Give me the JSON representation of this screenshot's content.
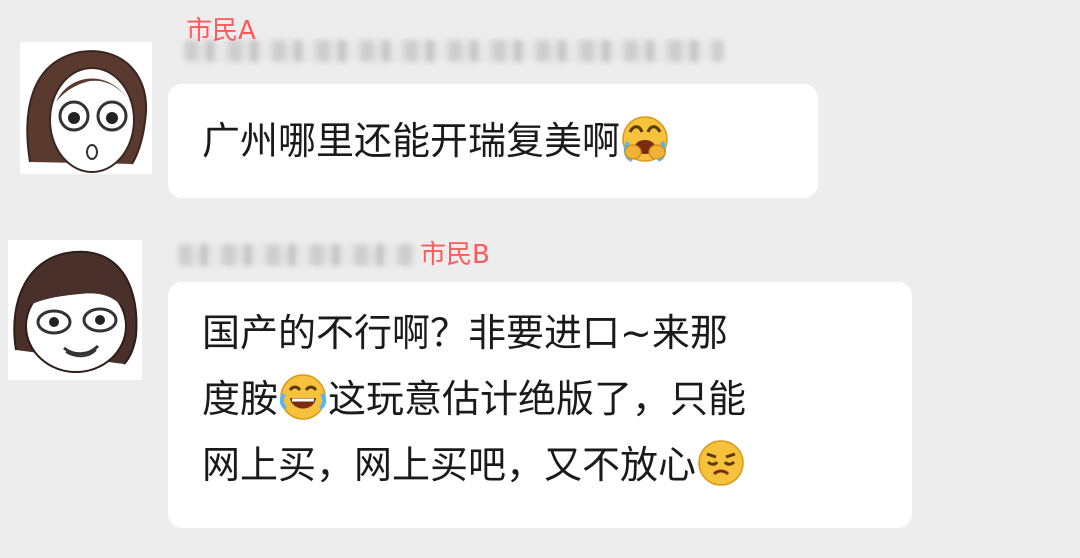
{
  "messages": [
    {
      "sender": "市民A",
      "text": "广州哪里还能开瑞复美啊",
      "emoji": "face-palm-crying-emoji"
    },
    {
      "sender": "市民B",
      "lines": [
        "国产的不行啊？非要进口~来那",
        "度胺",
        "这玩意估计绝版了，只能",
        "网上买，网上买吧，又不放心"
      ],
      "emojis": [
        "laugh-crying-emoji",
        "worried-face-emoji"
      ]
    }
  ],
  "colors": {
    "background": "#ededed",
    "bubble": "#ffffff",
    "sender_name": "#ff5a5a"
  }
}
